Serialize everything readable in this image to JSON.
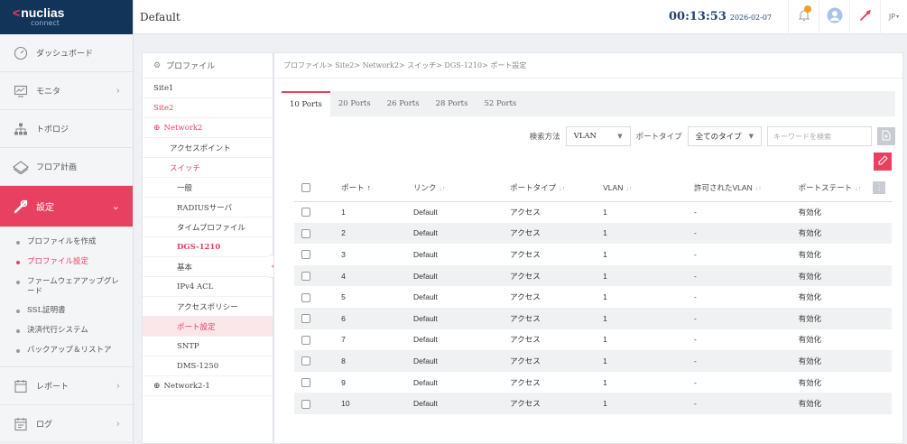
{
  "app": {
    "logo_text": "nuclias",
    "logo_sub": "connect"
  },
  "header": {
    "title": "Default",
    "time": "00:13:53",
    "date": "2026-02-07",
    "language": "JP"
  },
  "sidebar": {
    "items": [
      {
        "label": "ダッシュボード",
        "icon": "dashboard-icon"
      },
      {
        "label": "モニタ",
        "icon": "monitor-icon",
        "chevron": "›"
      },
      {
        "label": "トポロジ",
        "icon": "topology-icon"
      },
      {
        "label": "フロア計画",
        "icon": "floorplan-icon"
      },
      {
        "label": "設定",
        "icon": "tools-icon",
        "chevron": "⌄",
        "active": true
      },
      {
        "label": "レポート",
        "icon": "report-icon",
        "chevron": "›"
      },
      {
        "label": "ログ",
        "icon": "log-icon",
        "chevron": "›"
      }
    ],
    "settings_submenu": [
      {
        "label": "プロファイルを作成"
      },
      {
        "label": "プロファイル設定",
        "active": true
      },
      {
        "label": "ファームウェアアップグレード"
      },
      {
        "label": "SSL証明書"
      },
      {
        "label": "決済代行システム"
      },
      {
        "label": "バックアップ＆リストア"
      }
    ]
  },
  "tree": {
    "header": "プロファイル",
    "rows": [
      {
        "label": "Site1"
      },
      {
        "label": "Site2"
      },
      {
        "label": "Network2"
      },
      {
        "label": "アクセスポイント"
      },
      {
        "label": "スイッチ"
      },
      {
        "label": "一般"
      },
      {
        "label": "RADIUSサーバ"
      },
      {
        "label": "タイムプロファイル"
      },
      {
        "label": "DGS-1210"
      },
      {
        "label": "基本"
      },
      {
        "label": "IPv4 ACL"
      },
      {
        "label": "アクセスポリシー"
      },
      {
        "label": "ポート設定"
      },
      {
        "label": "SNTP"
      },
      {
        "label": "DMS-1250"
      },
      {
        "label": "Network2-1"
      }
    ]
  },
  "main": {
    "breadcrumb": "プロファイル> Site2> Network2> スイッチ> DGS-1210> ポート設定",
    "tabs": [
      {
        "label": "10 Ports",
        "active": true
      },
      {
        "label": "20 Ports"
      },
      {
        "label": "26 Ports"
      },
      {
        "label": "28 Ports"
      },
      {
        "label": "52 Ports"
      }
    ],
    "toolbar": {
      "search_method_label": "検索方法",
      "search_method_value": "VLAN",
      "port_type_label": "ポートタイプ",
      "port_type_value": "全てのタイプ",
      "search_placeholder": "キーワードを検索"
    },
    "table": {
      "columns": [
        "ポート",
        "リンク",
        "ポートタイプ",
        "VLAN",
        "許可されたVLAN",
        "ポートステート"
      ],
      "sort_primary": "↑",
      "sort_secondary": "↓↑",
      "rows": [
        {
          "port": "1",
          "link": "Default",
          "type": "アクセス",
          "vlan": "1",
          "allowed": "-",
          "state": "有効化"
        },
        {
          "port": "2",
          "link": "Default",
          "type": "アクセス",
          "vlan": "1",
          "allowed": "-",
          "state": "有効化"
        },
        {
          "port": "3",
          "link": "Default",
          "type": "アクセス",
          "vlan": "1",
          "allowed": "-",
          "state": "有効化"
        },
        {
          "port": "4",
          "link": "Default",
          "type": "アクセス",
          "vlan": "1",
          "allowed": "-",
          "state": "有効化"
        },
        {
          "port": "5",
          "link": "Default",
          "type": "アクセス",
          "vlan": "1",
          "allowed": "-",
          "state": "有効化"
        },
        {
          "port": "6",
          "link": "Default",
          "type": "アクセス",
          "vlan": "1",
          "allowed": "-",
          "state": "有効化"
        },
        {
          "port": "7",
          "link": "Default",
          "type": "アクセス",
          "vlan": "1",
          "allowed": "-",
          "state": "有効化"
        },
        {
          "port": "8",
          "link": "Default",
          "type": "アクセス",
          "vlan": "1",
          "allowed": "-",
          "state": "有効化"
        },
        {
          "port": "9",
          "link": "Default",
          "type": "アクセス",
          "vlan": "1",
          "allowed": "-",
          "state": "有効化"
        },
        {
          "port": "10",
          "link": "Default",
          "type": "アクセス",
          "vlan": "1",
          "allowed": "-",
          "state": "有効化"
        }
      ]
    }
  },
  "colors": {
    "accent": "#e84061",
    "logo_bg": "#123458",
    "clock": "#1f4470"
  }
}
